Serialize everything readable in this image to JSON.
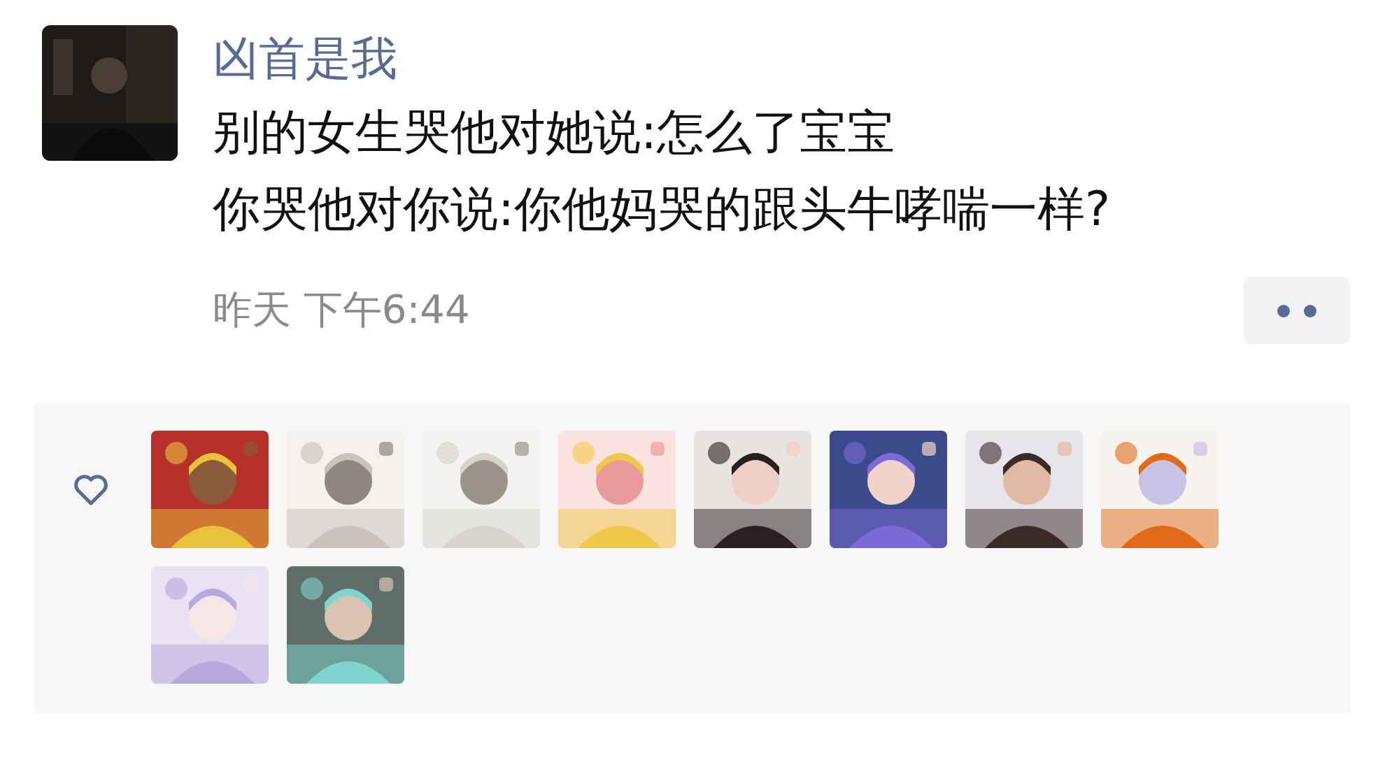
{
  "post": {
    "author": "凶首是我",
    "lines": [
      "别的女生哭他对她说:怎么了宝宝",
      "你哭他对你说:你他妈哭的跟头牛哮喘一样?"
    ],
    "time": "昨天 下午6:44"
  }
}
